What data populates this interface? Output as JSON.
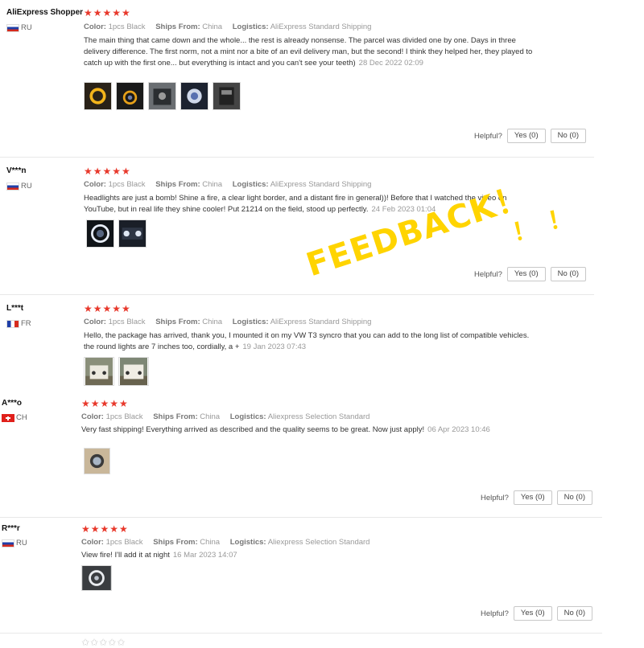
{
  "labels": {
    "color": "Color:",
    "ships_from": "Ships From:",
    "logistics": "Logistics:",
    "helpful": "Helpful?"
  },
  "reviews": [
    {
      "user": "AliExpress Shopper",
      "country": "RU",
      "flag": "ru",
      "stars": "★★★★★",
      "color": "1pcs Black",
      "ships_from": "China",
      "logistics": "AliExpress Standard Shipping",
      "text": "The main thing that came down and the whole... the rest is already nonsense. The parcel was divided one by one. Days in three delivery difference. The first norm, not a mint nor a bite of an evil delivery man, but the second! I think they helped her, they played to catch up with the first one... but everything is intact and you can't see your teeth)",
      "date": "28 Dec 2022 02:09",
      "yes": "Yes (0)",
      "no": "No (0)"
    },
    {
      "user": "V***n",
      "country": "RU",
      "flag": "ru",
      "stars": "★★★★★",
      "color": "1pcs Black",
      "ships_from": "China",
      "logistics": "AliExpress Standard Shipping",
      "text": "Headlights are just a bomb! Shine a fire, a clear light border, and a distant fire in general))! Before that I watched the video on YouTube, but in real life they shine cooler! Put 21214 on the field, stood up perfectly.",
      "date": "24 Feb 2023 01:04",
      "yes": "Yes (0)",
      "no": "No (0)"
    },
    {
      "user": "L***t",
      "country": "FR",
      "flag": "fr",
      "stars": "★★★★★",
      "color": "1pcs Black",
      "ships_from": "China",
      "logistics": "AliExpress Standard Shipping",
      "text": "Hello, the package has arrived, thank you, I mounted it on my VW T3 syncro that you can add to the long list of compatible vehicles. the round lights are 7 inches too, cordially, a +",
      "date": "19 Jan 2023 07:43"
    },
    {
      "user": "A***o",
      "country": "CH",
      "flag": "ch",
      "stars": "★★★★★",
      "color": "1pcs Black",
      "ships_from": "China",
      "logistics": "Aliexpress Selection Standard",
      "text": "Very fast shipping! Everything arrived as described and the quality seems to be great. Now just apply!",
      "date": "06 Apr 2023 10:46",
      "yes": "Yes (0)",
      "no": "No (0)"
    },
    {
      "user": "R***r",
      "country": "RU",
      "flag": "ru",
      "stars": "★★★★★",
      "color": "1pcs Black",
      "ships_from": "China",
      "logistics": "Aliexpress Selection Standard",
      "text": "View fire! I'll add it at night",
      "date": "16 Mar 2023 14:07",
      "yes": "Yes (0)",
      "no": "No (0)"
    }
  ],
  "overlay": {
    "stamp": "FEEDBACK！",
    "bang1": "！",
    "bang2": "！"
  },
  "colors": {
    "star": "#e8382b",
    "stamp": "#ffd400"
  }
}
